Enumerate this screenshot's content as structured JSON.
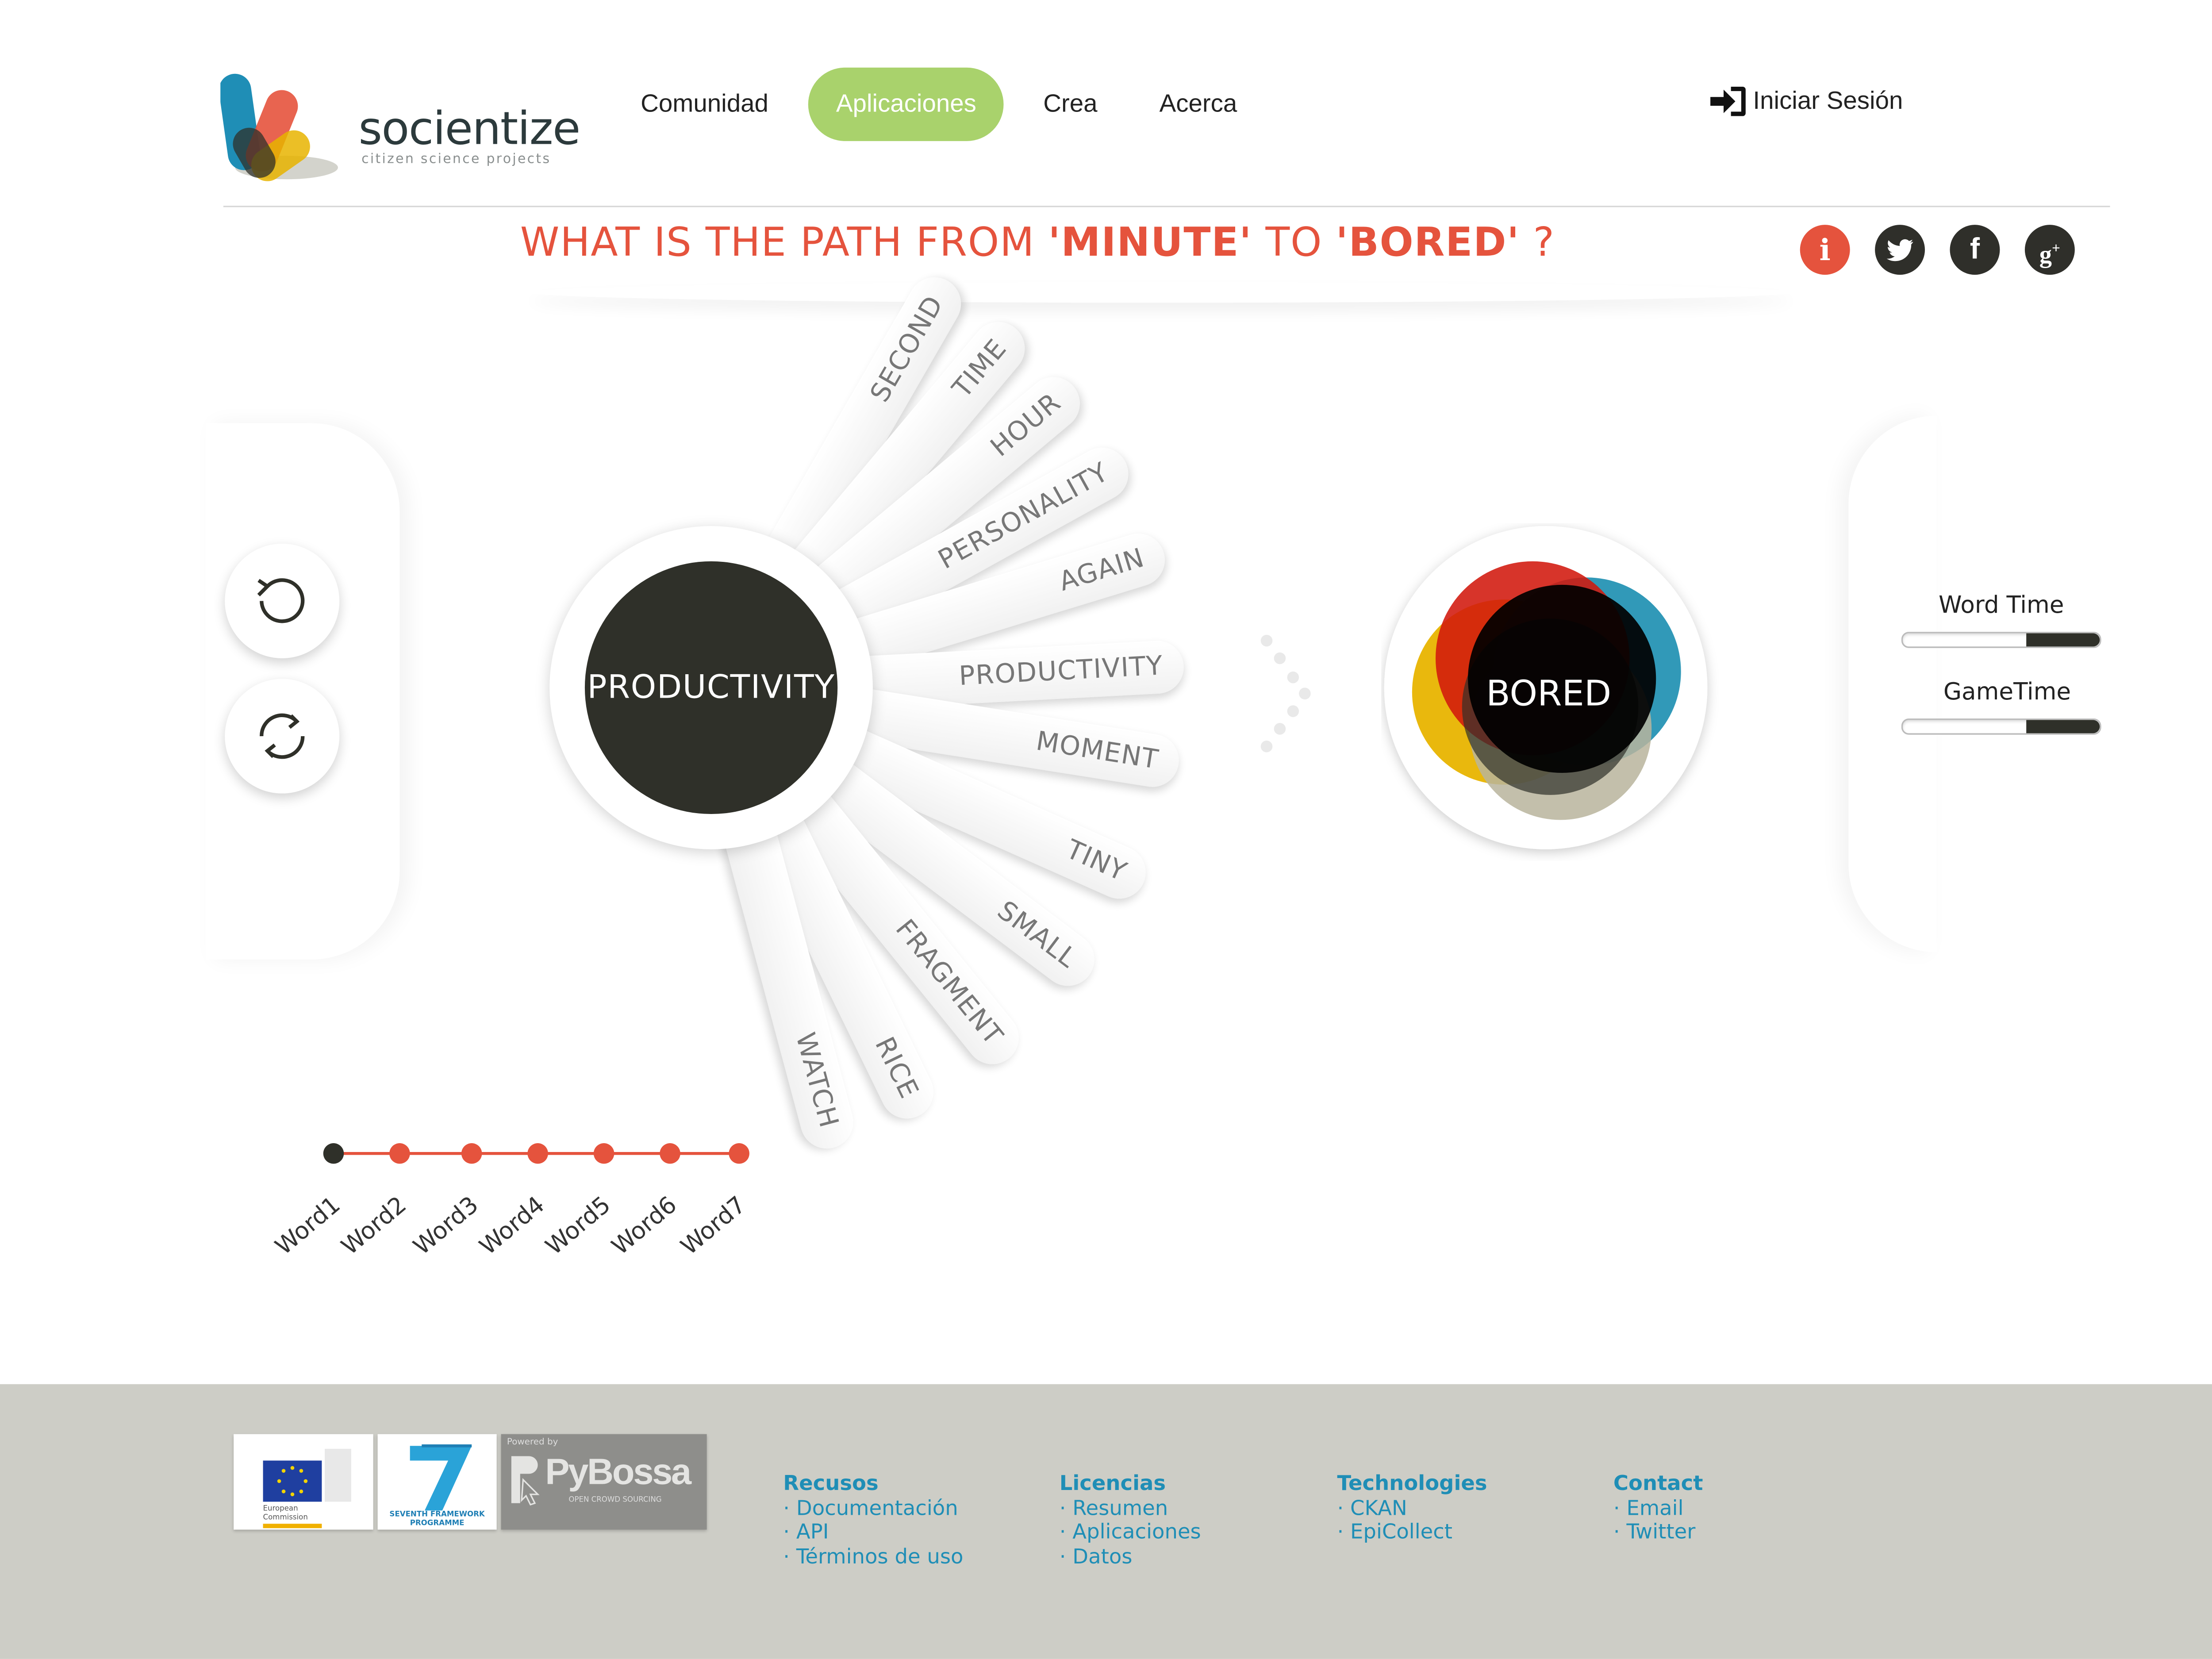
{
  "header": {
    "logo_text": "socientize",
    "logo_tagline": "citizen science projects",
    "nav": [
      "Comunidad",
      "Aplicaciones",
      "Crea",
      "Acerca"
    ],
    "active_nav": "Aplicaciones",
    "login_label": "Iniciar Sesión"
  },
  "question": {
    "prefix": "WHAT IS THE PATH FROM ",
    "from": "'MINUTE'",
    "middle": " TO ",
    "to": "'BORED'",
    "suffix": " ?"
  },
  "social": [
    "info-icon",
    "twitter-icon",
    "facebook-icon",
    "google-plus-icon"
  ],
  "game": {
    "current_word": "PRODUCTIVITY",
    "target_word": "BORED",
    "candidates": [
      "SECOND",
      "TIME",
      "HOUR",
      "PERSONALITY",
      "AGAIN",
      "PRODUCTIVITY",
      "MOMENT",
      "TINY",
      "SMALL",
      "FRAGMENT",
      "RICE",
      "WATCH"
    ]
  },
  "controls": {
    "undo": "undo-icon",
    "restart": "refresh-icon",
    "word_time_label": "Word Time",
    "word_time_remaining": 0.37,
    "game_time_label": "GameTime",
    "game_time_remaining": 0.37
  },
  "timeline": {
    "words": [
      "Word1",
      "Word2",
      "Word3",
      "Word4",
      "Word5",
      "Word6",
      "Word7"
    ],
    "current_index": 0
  },
  "colors": {
    "accent": "#e5533d",
    "nav_active": "#a9d26c",
    "dark": "#2f3029",
    "footer_bg": "#cdcdc6",
    "footer_link": "#1f8eb6"
  },
  "footer": {
    "partners": [
      "European Commission",
      "SEVENTH FRAMEWORK PROGRAMME",
      "PyBossa"
    ],
    "eu_caption": "European Commission",
    "fp7_caption": "SEVENTH FRAMEWORK PROGRAMME",
    "pybossa_powered": "Powered by",
    "pybossa_name": "PyBossa",
    "pybossa_sub": "OPEN CROWD SOURCING",
    "columns": [
      {
        "title": "Recusos",
        "items": [
          "Documentación",
          "API",
          "Términos de uso"
        ]
      },
      {
        "title": "Licencias",
        "items": [
          "Resumen",
          "Aplicaciones",
          "Datos"
        ]
      },
      {
        "title": "Technologies",
        "items": [
          "CKAN",
          "EpiCollect"
        ]
      },
      {
        "title": "Contact",
        "items": [
          "Email",
          "Twitter"
        ]
      }
    ]
  }
}
